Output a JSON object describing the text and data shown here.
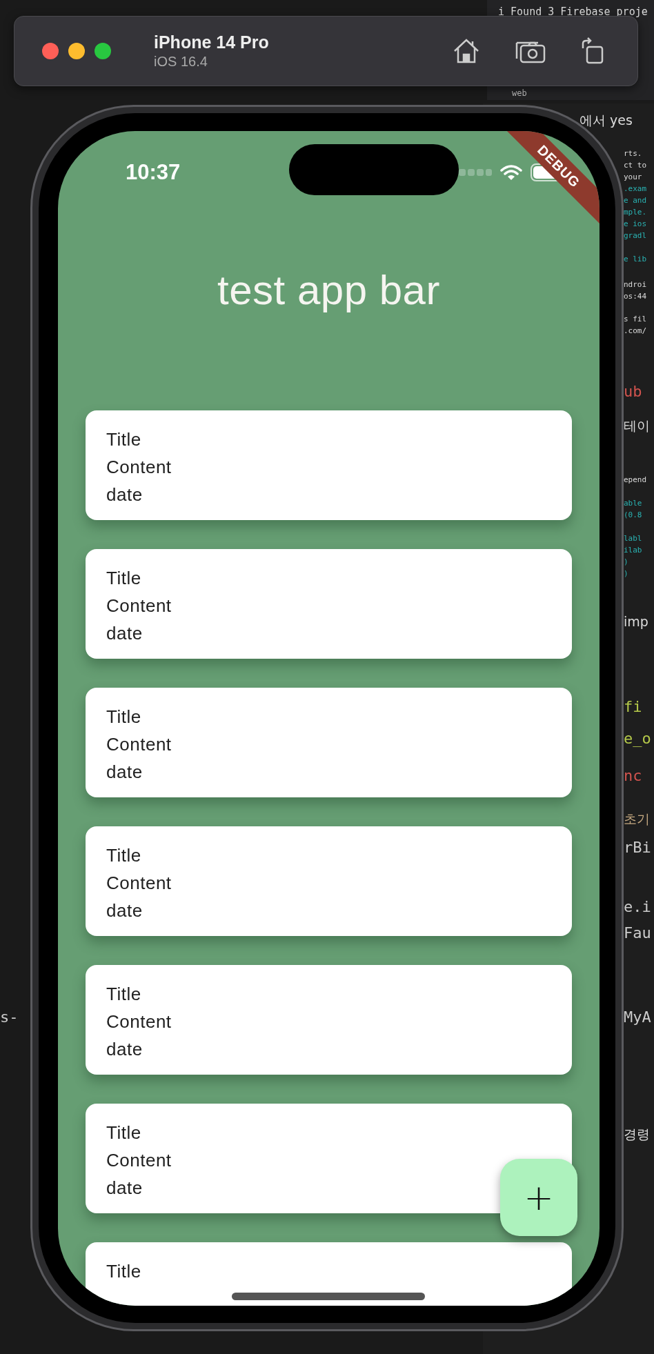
{
  "simulator": {
    "device_name": "iPhone 14 Pro",
    "os_version": "iOS 16.4"
  },
  "background_editor": {
    "terminal_lines": [
      "i Found 3 Firebase proje",
      "web"
    ],
    "fragments": [
      {
        "text": "에서 yes",
        "kind": "heading"
      },
      {
        "text": "rts.",
        "kind": "code"
      },
      {
        "text": "ct to",
        "kind": "code"
      },
      {
        "text": "your",
        "kind": "code"
      },
      {
        "text": ".exam",
        "kind": "accent"
      },
      {
        "text": "e and",
        "kind": "accent"
      },
      {
        "text": "mple.",
        "kind": "accent"
      },
      {
        "text": "e ios",
        "kind": "accent"
      },
      {
        "text": "gradl",
        "kind": "accent"
      },
      {
        "text": "e lib",
        "kind": "accent"
      },
      {
        "text": "ndroi",
        "kind": "code"
      },
      {
        "text": "os:44",
        "kind": "code"
      },
      {
        "text": "s fil",
        "kind": "code"
      },
      {
        "text": ".com/",
        "kind": "code"
      },
      {
        "text": "ub",
        "kind": "error"
      },
      {
        "text": "테이",
        "kind": "heading"
      },
      {
        "text": "epend",
        "kind": "code"
      },
      {
        "text": "able",
        "kind": "accent"
      },
      {
        "text": "(0.8",
        "kind": "accent"
      },
      {
        "text": "labl",
        "kind": "accent"
      },
      {
        "text": "ilab",
        "kind": "accent"
      },
      {
        "text": ")",
        "kind": "accent"
      },
      {
        "text": ")",
        "kind": "accent"
      },
      {
        "text": "imp",
        "kind": "heading"
      },
      {
        "text": "fi",
        "kind": "keyword"
      },
      {
        "text": "e_o",
        "kind": "keyword"
      },
      {
        "text": "nc",
        "kind": "error"
      },
      {
        "text": "초기",
        "kind": "comment"
      },
      {
        "text": "rBi",
        "kind": "plain"
      },
      {
        "text": "e.i",
        "kind": "plain"
      },
      {
        "text": "Fau",
        "kind": "plain"
      },
      {
        "text": "MyA",
        "kind": "plain"
      },
      {
        "text": "경령",
        "kind": "heading"
      },
      {
        "text": "s-",
        "kind": "plain"
      }
    ]
  },
  "status_bar": {
    "time": "10:37"
  },
  "debug_banner": "DEBUG",
  "app_bar": {
    "title": "test app bar"
  },
  "cards": [
    {
      "title": "Title",
      "content": "Content",
      "date": "date"
    },
    {
      "title": "Title",
      "content": "Content",
      "date": "date"
    },
    {
      "title": "Title",
      "content": "Content",
      "date": "date"
    },
    {
      "title": "Title",
      "content": "Content",
      "date": "date"
    },
    {
      "title": "Title",
      "content": "Content",
      "date": "date"
    },
    {
      "title": "Title",
      "content": "Content",
      "date": "date"
    },
    {
      "title": "Title"
    }
  ],
  "fab": {
    "label": "+"
  }
}
